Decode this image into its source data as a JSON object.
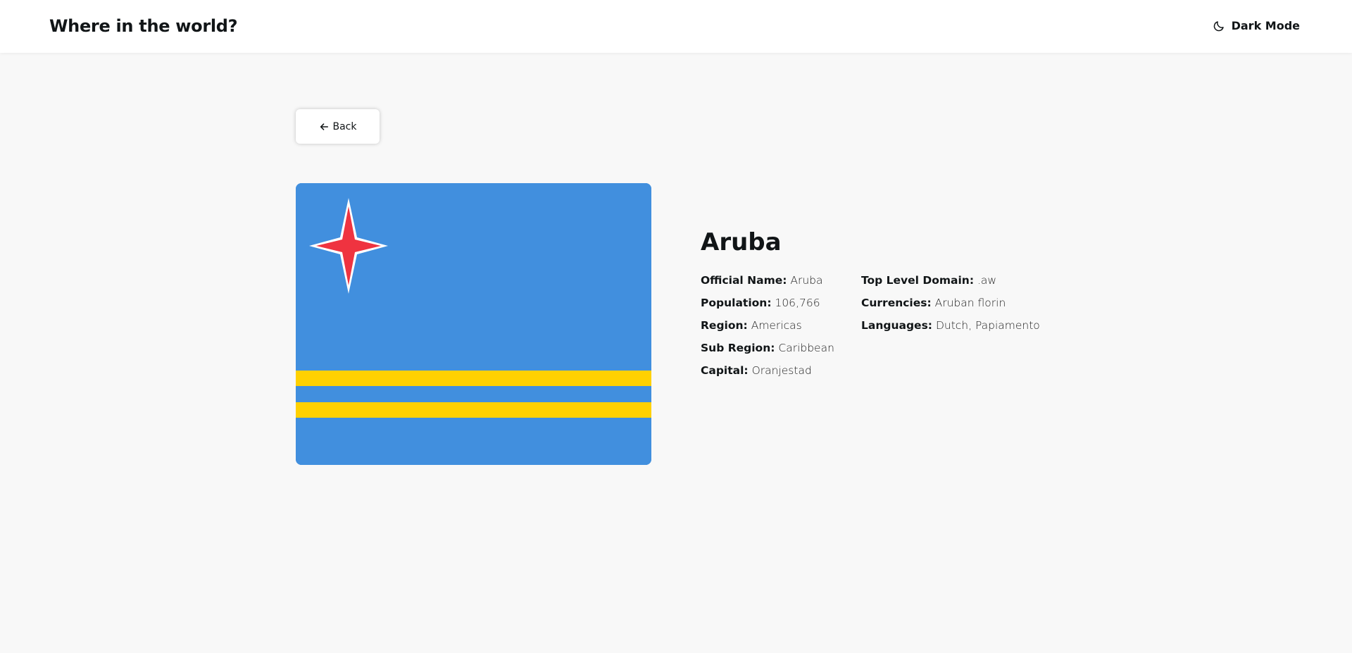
{
  "header": {
    "title": "Where in the world?",
    "dark_mode_label": "Dark Mode",
    "dark_mode_icon": "moon-icon"
  },
  "back": {
    "label": "Back",
    "icon": "arrow-left-icon"
  },
  "country": {
    "name": "Aruba",
    "flag_icon": "aruba-flag",
    "left_details": [
      {
        "label": "Official Name:",
        "value": "Aruba"
      },
      {
        "label": "Population:",
        "value": "106,766"
      },
      {
        "label": "Region:",
        "value": "Americas"
      },
      {
        "label": "Sub Region:",
        "value": "Caribbean"
      },
      {
        "label": "Capital:",
        "value": "Oranjestad"
      }
    ],
    "right_details": [
      {
        "label": "Top Level Domain:",
        "value": ".aw"
      },
      {
        "label": "Currencies:",
        "value": " Aruban florin"
      },
      {
        "label": "Languages:",
        "value": " Dutch,  Papiamento"
      }
    ]
  },
  "colors": {
    "background": "#f8f8f8",
    "header_bg": "#ffffff",
    "flag_blue": "#418fde",
    "flag_yellow": "#ffd100",
    "flag_red": "#ef3340"
  }
}
